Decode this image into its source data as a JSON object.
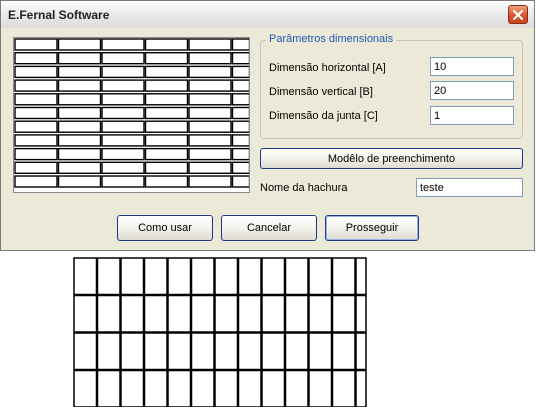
{
  "window": {
    "title": "E.Fernal Software",
    "close_icon": "close-icon",
    "accent": "#d9532e"
  },
  "params": {
    "group_label": "Parâmetros dimensionais",
    "horizontal": {
      "label": "Dimensão horizontal [A]",
      "value": "10"
    },
    "vertical": {
      "label": "Dimensão vertical [B]",
      "value": "20"
    },
    "joint": {
      "label": "Dimensão da junta [C]",
      "value": "1"
    }
  },
  "fill_model_button": "Modêlo de preenchimento",
  "hatch": {
    "label": "Nome da hachura",
    "value": "teste"
  },
  "buttons": {
    "how_to_use": "Como usar",
    "cancel": "Cancelar",
    "proceed": "Prosseguir"
  },
  "preview": {
    "rows": 11,
    "cols": 5,
    "brick_w": 43,
    "brick_h": 12
  },
  "large_pattern": {
    "rows": 4,
    "cols": 13
  }
}
